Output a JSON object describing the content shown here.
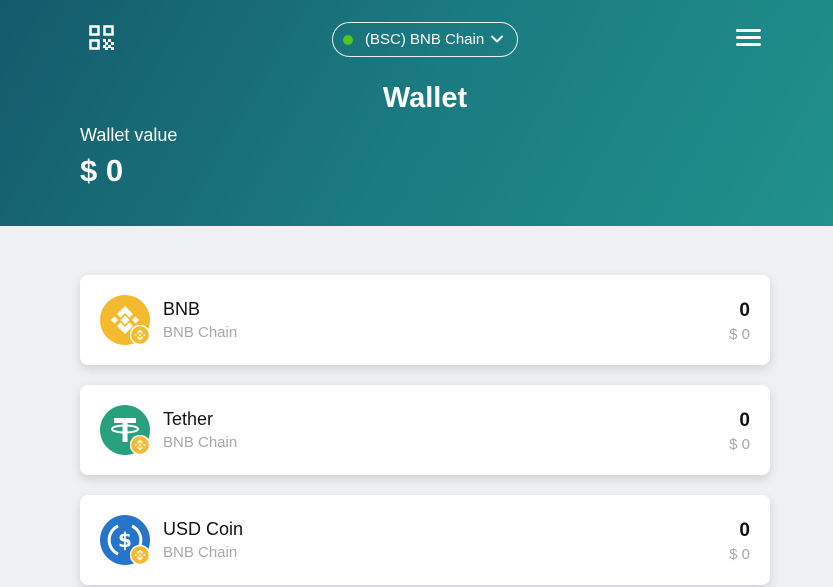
{
  "header": {
    "network_label": "(BSC) BNB Chain",
    "network_status_color": "#52c41a",
    "title": "Wallet",
    "wallet_value_label": "Wallet value",
    "wallet_value": "$ 0"
  },
  "icons": {
    "qr": "qr-code-icon",
    "menu": "hamburger-menu-icon",
    "dropdown": "chevron-down-icon"
  },
  "assets": [
    {
      "name": "BNB",
      "chain": "BNB Chain",
      "amount": "0",
      "fiat": "$ 0",
      "icon": "bnb-coin-icon",
      "color": "#f3ba2f"
    },
    {
      "name": "Tether",
      "chain": "BNB Chain",
      "amount": "0",
      "fiat": "$ 0",
      "icon": "tether-coin-icon",
      "color": "#26a17b"
    },
    {
      "name": "USD Coin",
      "chain": "BNB Chain",
      "amount": "0",
      "fiat": "$ 0",
      "icon": "usdc-coin-icon",
      "color": "#2775ca"
    }
  ],
  "colors": {
    "header_gradient_start": "#145a6c",
    "header_gradient_end": "#21918c",
    "background": "#eef0f3"
  }
}
